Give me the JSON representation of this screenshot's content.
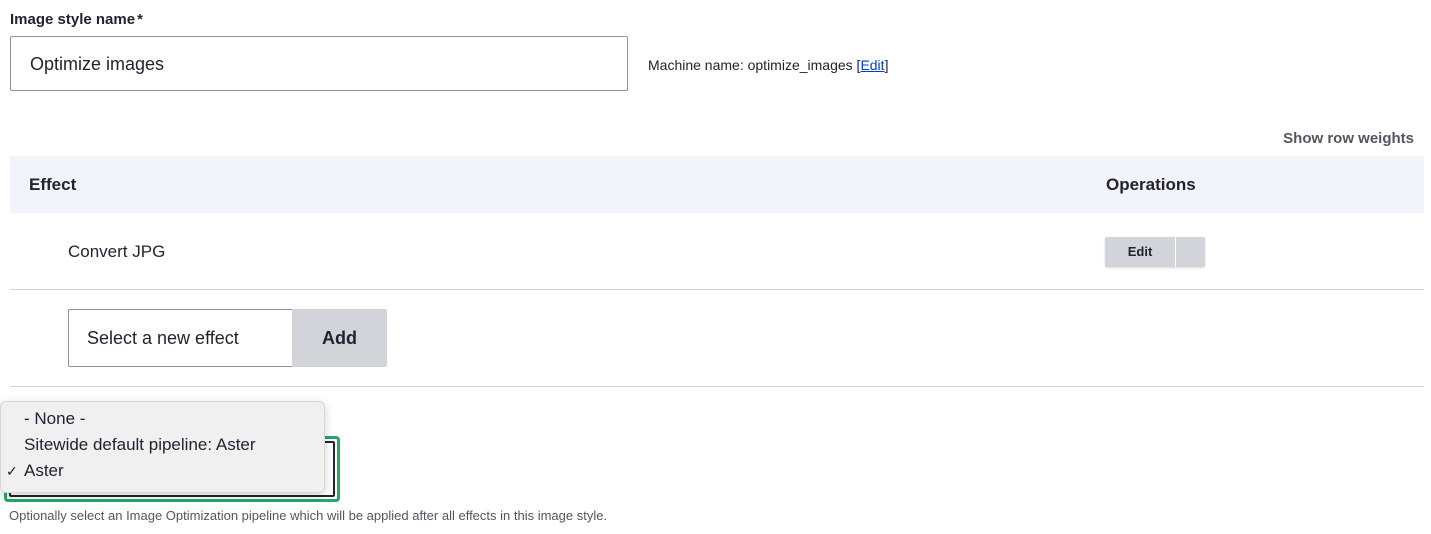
{
  "form": {
    "name_label": "Image style name",
    "required_mark": "*",
    "name_value": "Optimize images",
    "machine_name_prefix": "Machine name: optimize_images [",
    "machine_name_edit": "Edit",
    "machine_name_suffix": "]"
  },
  "table": {
    "show_row_weights": "Show row weights",
    "headers": {
      "effect": "Effect",
      "operations": "Operations"
    },
    "rows": [
      {
        "effect": "Convert JPG",
        "operation": "Edit"
      }
    ],
    "new_effect_placeholder": "Select a new effect",
    "add_label": "Add"
  },
  "pipeline": {
    "options": [
      "- None -",
      "Sitewide default pipeline: Aster",
      "Aster"
    ],
    "selected": "Aster",
    "check_glyph": "✓",
    "description": "Optionally select an Image Optimization pipeline which will be applied after all effects in this image style."
  },
  "colors": {
    "focus_ring": "#26a769",
    "link": "#003ecc",
    "header_bg": "#f3f4f9",
    "button_bg": "#d3d4d9"
  }
}
